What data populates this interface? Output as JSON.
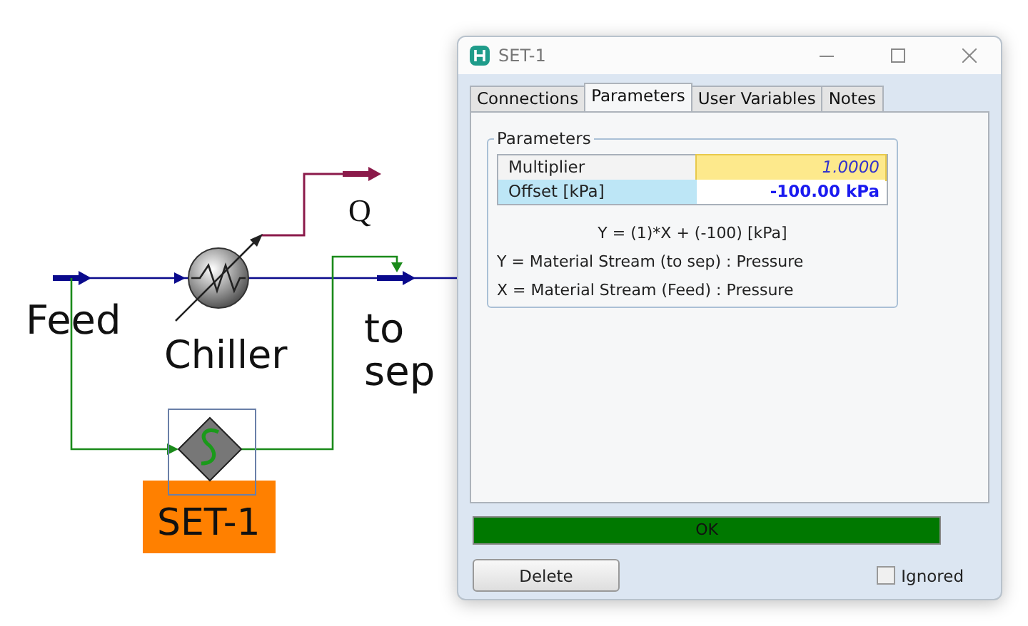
{
  "flowsheet": {
    "streams": [
      {
        "label": "Feed",
        "kind": "material"
      },
      {
        "label": "to sep",
        "kind": "material"
      },
      {
        "label": "Q",
        "kind": "energy"
      }
    ],
    "units": [
      {
        "label": "Chiller",
        "kind": "cooler"
      },
      {
        "label": "SET-1",
        "kind": "set",
        "selected": true
      }
    ]
  },
  "window": {
    "title": "SET-1"
  },
  "tabs": [
    {
      "label": "Connections",
      "selected": false
    },
    {
      "label": "Parameters",
      "selected": true
    },
    {
      "label": "User Variables",
      "selected": false
    },
    {
      "label": "Notes",
      "selected": false
    }
  ],
  "parameters": {
    "title": "Parameters",
    "rows": [
      {
        "name": "Multiplier",
        "value": "1.0000",
        "kind": "specified",
        "selected": false
      },
      {
        "name": "Offset [kPa]",
        "value": "-100.00 kPa",
        "kind": "calculated",
        "selected": true
      }
    ],
    "equation": "Y = (1)*X + (-100) [kPa]",
    "definitions": [
      "Y = Material Stream (to sep) : Pressure",
      "X = Material Stream (Feed) : Pressure"
    ]
  },
  "status_bar": {
    "text": "OK"
  },
  "buttons": {
    "delete": "Delete"
  },
  "ignored": {
    "label": "Ignored",
    "checked": false
  }
}
